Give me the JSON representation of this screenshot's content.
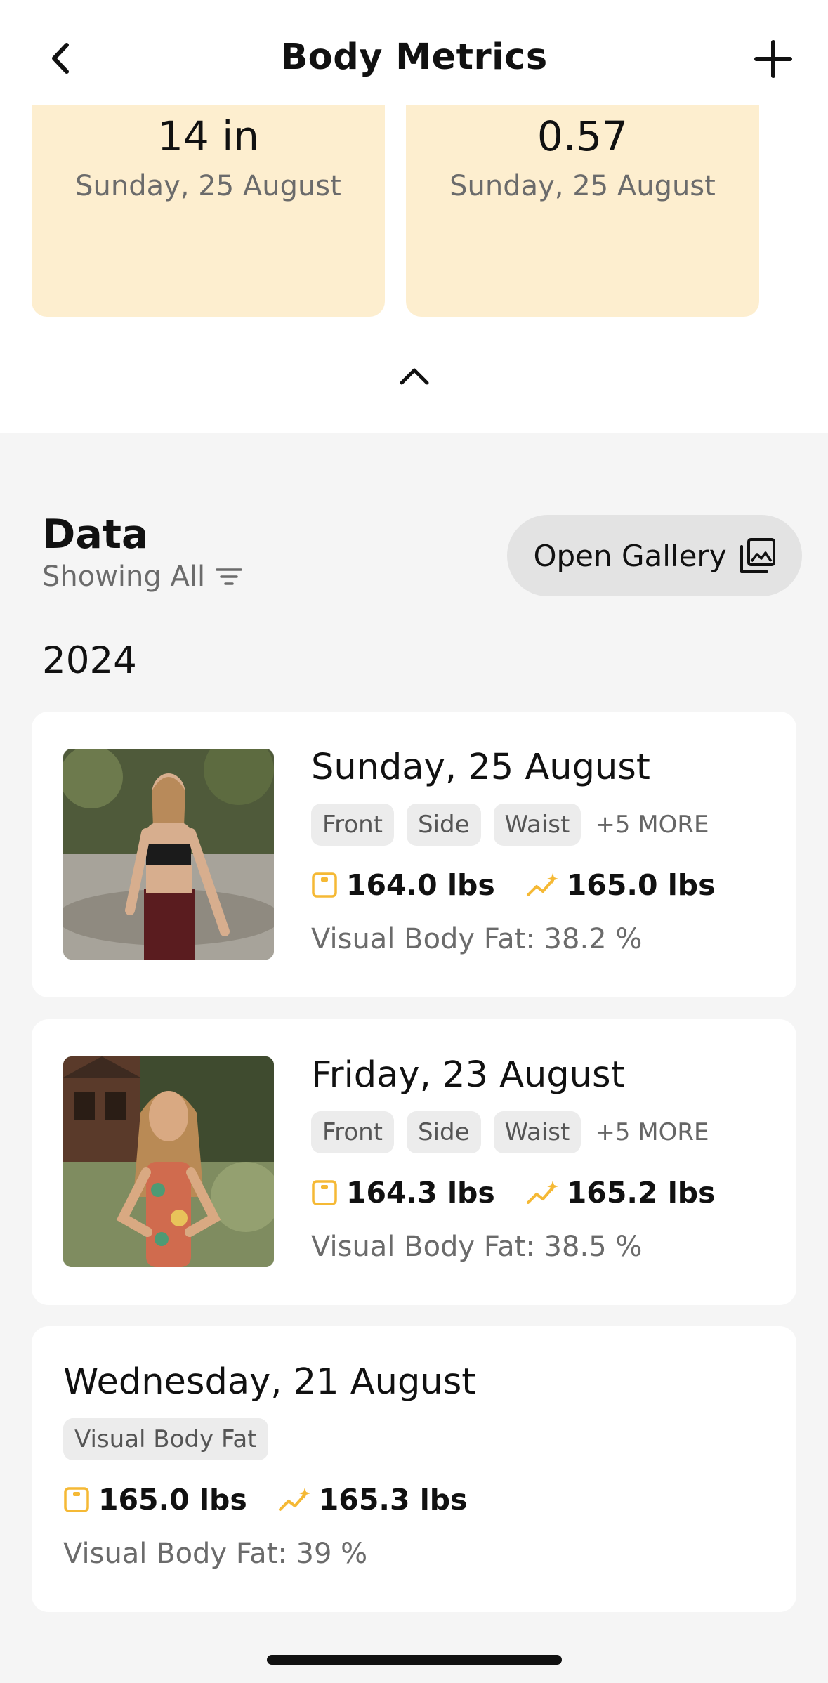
{
  "header": {
    "title": "Body Metrics",
    "back_icon": "chevron-left-icon",
    "add_icon": "plus-icon"
  },
  "metric_cards": [
    {
      "value": "14 in",
      "date": "Sunday, 25 August"
    },
    {
      "value": "0.57",
      "date": "Sunday, 25 August"
    }
  ],
  "data_section": {
    "title": "Data",
    "filter_label": "Showing All",
    "gallery_button": "Open Gallery",
    "year": "2024"
  },
  "entries": [
    {
      "date": "Sunday, 25 August",
      "tags": [
        "Front",
        "Side",
        "Waist"
      ],
      "more": "+5 MORE",
      "scale_weight": "164.0 lbs",
      "trend_weight": "165.0 lbs",
      "body_fat": "Visual Body Fat: 38.2 %",
      "has_photo": true
    },
    {
      "date": "Friday, 23 August",
      "tags": [
        "Front",
        "Side",
        "Waist"
      ],
      "more": "+5 MORE",
      "scale_weight": "164.3 lbs",
      "trend_weight": "165.2 lbs",
      "body_fat": "Visual Body Fat: 38.5 %",
      "has_photo": true
    },
    {
      "date": "Wednesday, 21 August",
      "tags": [
        "Visual Body Fat"
      ],
      "scale_weight": "165.0 lbs",
      "trend_weight": "165.3 lbs",
      "body_fat": "Visual Body Fat: 39 %",
      "has_photo": false
    }
  ],
  "colors": {
    "card_accent": "#fdeecf",
    "icon_accent": "#f5b935",
    "background": "#f5f5f5"
  }
}
